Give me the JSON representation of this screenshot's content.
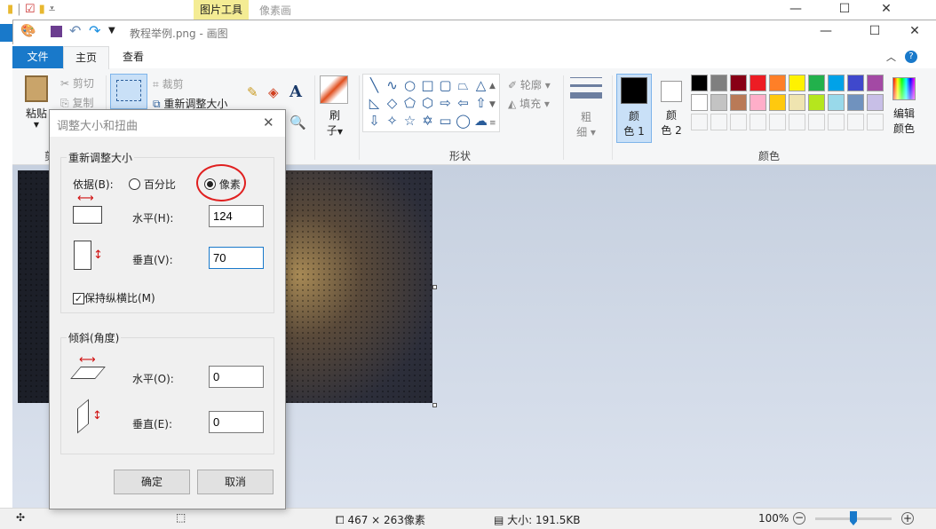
{
  "explorer": {
    "context_tab": "图片工具",
    "title": "像素画"
  },
  "window": {
    "title": "教程举例.png - 画图"
  },
  "tabs": [
    {
      "label": "文件"
    },
    {
      "label": "主页"
    },
    {
      "label": "查看"
    }
  ],
  "ribbon": {
    "clipboard": {
      "paste": "粘贴",
      "cut": "剪切",
      "copy": "复制",
      "group_partial": "剪"
    },
    "image": {
      "crop": "裁剪",
      "resize": "重新调整大小"
    },
    "brush": {
      "line1": "刷",
      "line2": "子"
    },
    "shapes": {
      "outline": "轮廓",
      "fill": "填充",
      "group": "形状"
    },
    "size": {
      "line1": "粗",
      "line2": "细"
    },
    "colors": {
      "color1_l1": "颜",
      "color1_l2": "色 1",
      "color2_l1": "颜",
      "color2_l2": "色 2",
      "edit_l1": "编辑",
      "edit_l2": "颜色",
      "group": "颜色",
      "color1": "#000000",
      "color2": "#ffffff",
      "palette": [
        "#000000",
        "#7f7f7f",
        "#880015",
        "#ed1c24",
        "#ff7f27",
        "#fff200",
        "#22b14c",
        "#00a2e8",
        "#3f48cc",
        "#a349a4",
        "#ffffff",
        "#c3c3c3",
        "#b97a57",
        "#ffaec9",
        "#ffc90e",
        "#efe4b0",
        "#b5e61d",
        "#99d9ea",
        "#7092be",
        "#c8bfe7"
      ]
    }
  },
  "dialog": {
    "title": "调整大小和扭曲",
    "resize_group": "重新调整大小",
    "by_label": "依据(B):",
    "percent": "百分比",
    "pixels": "像素",
    "selected": "pixels",
    "h_label": "水平(H):",
    "h_value": "124",
    "v_label": "垂直(V):",
    "v_value": "70",
    "keep_ratio": "保持纵横比(M)",
    "keep_ratio_checked": true,
    "skew_group": "倾斜(角度)",
    "skew_h_label": "水平(O):",
    "skew_h_value": "0",
    "skew_v_label": "垂直(E):",
    "skew_v_value": "0",
    "ok": "确定",
    "cancel": "取消"
  },
  "status": {
    "dimensions": "467 × 263像素",
    "size": "大小: 191.5KB",
    "zoom": "100%",
    "zoom_level": 100
  }
}
